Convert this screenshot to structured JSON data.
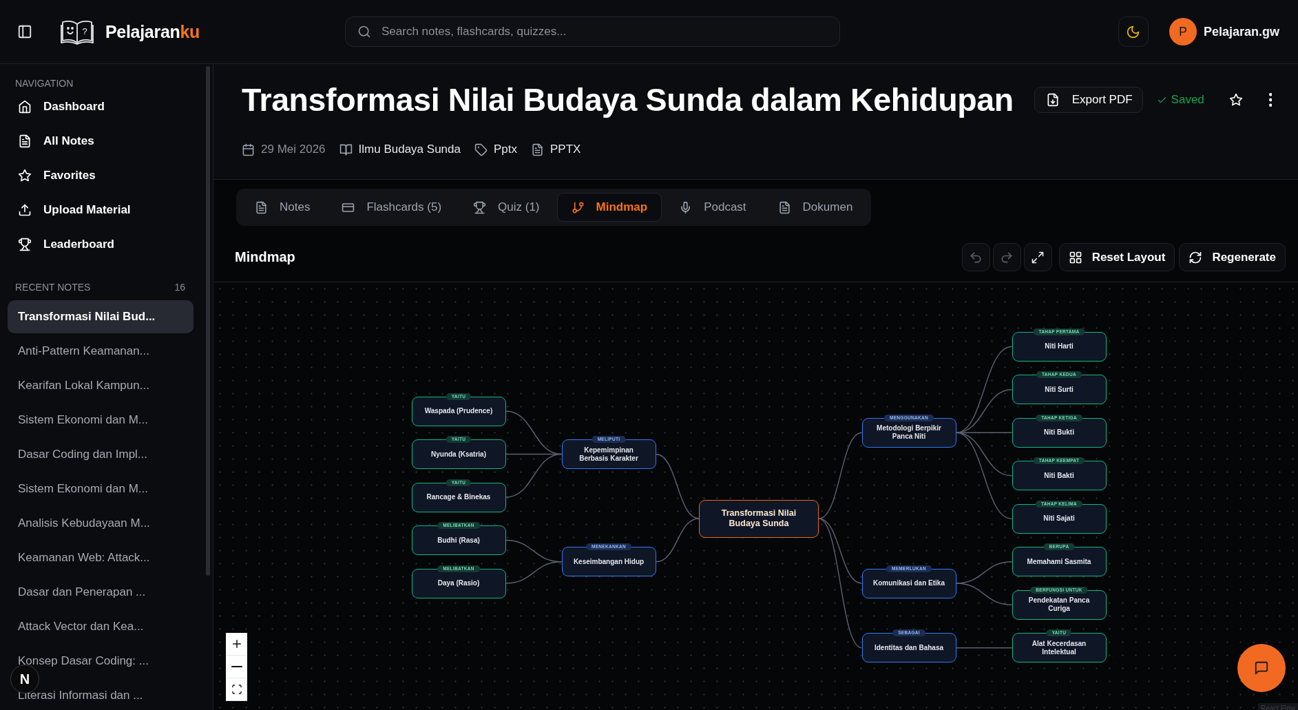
{
  "header": {
    "brand": {
      "name": "Pelajaran",
      "accent": "ku",
      "logo_glyph": "?"
    },
    "search": {
      "placeholder": "Search notes, flashcards, quizzes..."
    },
    "user": {
      "initial": "P",
      "name": "Pelajaran.gw"
    }
  },
  "sidebar": {
    "nav_heading": "NAVIGATION",
    "nav": [
      {
        "label": "Dashboard"
      },
      {
        "label": "All Notes"
      },
      {
        "label": "Favorites"
      },
      {
        "label": "Upload Material"
      },
      {
        "label": "Leaderboard"
      }
    ],
    "recent_heading": "RECENT NOTES",
    "recent_count": "16",
    "recent": [
      {
        "title": "Transformasi Nilai Bud...",
        "selected": true
      },
      {
        "title": "Anti-Pattern Keamanan...",
        "selected": false
      },
      {
        "title": "Kearifan Lokal Kampun...",
        "selected": false
      },
      {
        "title": "Sistem Ekonomi dan M...",
        "selected": false
      },
      {
        "title": "Dasar Coding dan Impl...",
        "selected": false
      },
      {
        "title": "Sistem Ekonomi dan M...",
        "selected": false
      },
      {
        "title": "Analisis Kebudayaan M...",
        "selected": false
      },
      {
        "title": "Keamanan Web: Attack...",
        "selected": false
      },
      {
        "title": "Dasar dan Penerapan ...",
        "selected": false
      },
      {
        "title": "Attack Vector dan Kea...",
        "selected": false
      },
      {
        "title": "Konsep Dasar Coding: ...",
        "selected": false
      },
      {
        "title": "Literasi Informasi dan ...",
        "selected": false
      }
    ],
    "dev_badge": "N"
  },
  "note": {
    "title": "Transformasi Nilai Budaya Sunda dalam Kehidupan",
    "export_label": "Export PDF",
    "save_status": "Saved",
    "favorite": false,
    "meta": [
      {
        "kind": "date",
        "text": "29 Mei 2026"
      },
      {
        "kind": "subject",
        "text": "Ilmu Budaya Sunda"
      },
      {
        "kind": "tag",
        "text": "Pptx"
      },
      {
        "kind": "file",
        "text": "PPTX"
      }
    ]
  },
  "tabs": [
    {
      "label": "Notes",
      "selected": false
    },
    {
      "label": "Flashcards (5)",
      "selected": false
    },
    {
      "label": "Quiz (1)",
      "selected": false
    },
    {
      "label": "Mindmap",
      "selected": true
    },
    {
      "label": "Podcast",
      "selected": false
    },
    {
      "label": "Dokumen",
      "selected": false
    }
  ],
  "mindmap": {
    "title": "Mindmap",
    "tools": [
      {
        "kind": "undo",
        "disabled": true
      },
      {
        "kind": "redo",
        "disabled": true
      },
      {
        "kind": "fit",
        "disabled": false
      }
    ],
    "actions": [
      {
        "kind": "layout",
        "label": "Reset Layout"
      },
      {
        "kind": "regenerate",
        "label": "Regenerate"
      }
    ],
    "root": {
      "label": "Transformasi Nilai Budaya Sunda",
      "children": [
        {
          "relation": "MELIPUTI",
          "label": "Kepemimpinan Berbasis Karakter",
          "children": [
            {
              "relation": "YAITU",
              "label": "Waspada (Prudence)"
            },
            {
              "relation": "YAITU",
              "label": "Nyunda (Ksatria)"
            },
            {
              "relation": "YAITU",
              "label": "Rancage & Binekas"
            }
          ]
        },
        {
          "relation": "MENEKANKAN",
          "label": "Keseimbangan Hidup",
          "children": [
            {
              "relation": "MELIBATKAN",
              "label": "Budhi (Rasa)"
            },
            {
              "relation": "MELIBATKAN",
              "label": "Daya (Rasio)"
            }
          ]
        },
        {
          "relation": "MENGGUNAKAN",
          "label": "Metodologi Berpikir Panca Niti",
          "children": [
            {
              "relation": "TAHAP PERTAMA",
              "label": "Niti Harti"
            },
            {
              "relation": "TAHAP KEDUA",
              "label": "Niti Surti"
            },
            {
              "relation": "TAHAP KETIGA",
              "label": "Niti Bukti"
            },
            {
              "relation": "TAHAP KEEMPAT",
              "label": "Niti Bakti"
            },
            {
              "relation": "TAHAP KELIMA",
              "label": "Niti Sajati"
            }
          ]
        },
        {
          "relation": "MEMERLUKAN",
          "label": "Komunikasi dan Etika",
          "children": [
            {
              "relation": "BERUPA",
              "label": "Memahami Sasmita"
            },
            {
              "relation": "BERFUNGSI UNTUK",
              "label": "Pendekatan Panca Curiga"
            }
          ]
        },
        {
          "relation": "SEBAGAI",
          "label": "Identitas dan Bahasa",
          "children": [
            {
              "relation": "YAITU",
              "label": "Alat Kecerdasan Intelektual"
            }
          ]
        }
      ]
    },
    "attribution": "React Flow"
  }
}
